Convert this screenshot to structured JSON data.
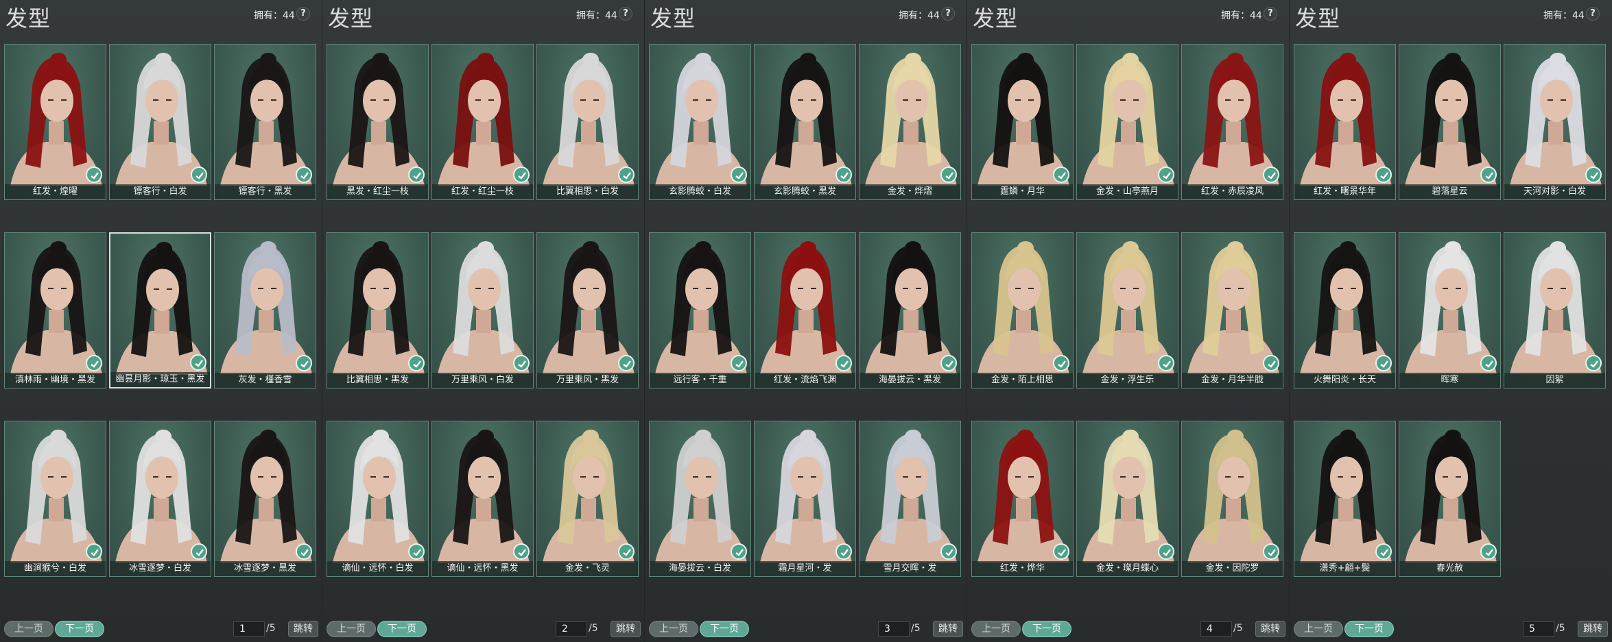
{
  "panels": [
    {
      "title": "发型",
      "owned": "拥有：44",
      "help": "?",
      "prev": "上一页",
      "next": "下一页",
      "page": "1",
      "total": "/5",
      "jump": "跳转",
      "items": [
        {
          "label": "红发・煌曜",
          "hair": "#8a1212"
        },
        {
          "label": "镖客行・白发",
          "hair": "#d8d8d8"
        },
        {
          "label": "镖客行・黑发",
          "hair": "#1a1616"
        },
        {
          "label": "滇林雨・幽境・黑发",
          "hair": "#181414"
        },
        {
          "label": "幽昙月影・琼玉・黑发",
          "hair": "#151212",
          "selected": true
        },
        {
          "label": "灰发・槿香雪",
          "hair": "#b8bcc8"
        },
        {
          "label": "幽涧猴兮・白发",
          "hair": "#dadada"
        },
        {
          "label": "冰雪逐梦・白发",
          "hair": "#e0e0e0"
        },
        {
          "label": "冰雪逐梦・黑发",
          "hair": "#1a1515"
        }
      ]
    },
    {
      "title": "发型",
      "owned": "拥有：44",
      "help": "?",
      "prev": "上一页",
      "next": "下一页",
      "page": "2",
      "total": "/5",
      "jump": "跳转",
      "items": [
        {
          "label": "黑发・红尘一枝",
          "hair": "#1a1515"
        },
        {
          "label": "红发・红尘一枝",
          "hair": "#7a1010"
        },
        {
          "label": "比翼相思・白发",
          "hair": "#d8d8d8"
        },
        {
          "label": "比翼相思・黑发",
          "hair": "#181414"
        },
        {
          "label": "万里乘风・白发",
          "hair": "#dcdcdc"
        },
        {
          "label": "万里乘风・黑发",
          "hair": "#1a1515"
        },
        {
          "label": "谪仙・远怀・白发",
          "hair": "#e2e2e2"
        },
        {
          "label": "谪仙・远怀・黑发",
          "hair": "#1a1515"
        },
        {
          "label": "金发・飞灵",
          "hair": "#d9c79a"
        }
      ]
    },
    {
      "title": "发型",
      "owned": "拥有：44",
      "help": "?",
      "prev": "上一页",
      "next": "下一页",
      "page": "3",
      "total": "/5",
      "jump": "跳转",
      "items": [
        {
          "label": "玄影腾蛟・白发",
          "hair": "#d4d6dc"
        },
        {
          "label": "玄影腾蛟・黑发",
          "hair": "#161313"
        },
        {
          "label": "金发・烨熠",
          "hair": "#e6d6a8"
        },
        {
          "label": "远行客・千重",
          "hair": "#171313"
        },
        {
          "label": "红发・流焰飞渊",
          "hair": "#8c1010"
        },
        {
          "label": "海晏拔云・黑发",
          "hair": "#141111"
        },
        {
          "label": "海晏拔云・白发",
          "hair": "#d0d0d0"
        },
        {
          "label": "霜月星河・发",
          "hair": "#d6d6dc"
        },
        {
          "label": "雪月交晖・发",
          "hair": "#c8ccd4"
        }
      ]
    },
    {
      "title": "发型",
      "owned": "拥有：44",
      "help": "?",
      "prev": "上一页",
      "next": "下一页",
      "page": "4",
      "total": "/5",
      "jump": "跳转",
      "items": [
        {
          "label": "霆鳞・月华",
          "hair": "#141111"
        },
        {
          "label": "金发・山亭燕月",
          "hair": "#e4d3a0"
        },
        {
          "label": "红发・赤辰凌风",
          "hair": "#8a1414"
        },
        {
          "label": "金发・陌上相思",
          "hair": "#d8c48e"
        },
        {
          "label": "金发・浮生乐",
          "hair": "#dcc892"
        },
        {
          "label": "金发・月华半胧",
          "hair": "#e0cc98"
        },
        {
          "label": "红发・烨华",
          "hair": "#8c1212"
        },
        {
          "label": "金发・璨月蝶心",
          "hair": "#e6dcb4"
        },
        {
          "label": "金发・因陀罗",
          "hair": "#d2c08c"
        }
      ]
    },
    {
      "title": "发型",
      "owned": "拥有：44",
      "help": "?",
      "prev": "上一页",
      "next": "下一页",
      "page": "5",
      "total": "/5",
      "jump": "跳转",
      "items": [
        {
          "label": "红发・曙景华年",
          "hair": "#861212"
        },
        {
          "label": "碧落星云",
          "hair": "#151212"
        },
        {
          "label": "天河对影・白发",
          "hair": "#dcdce4"
        },
        {
          "label": "火舞阳炎・长天",
          "hair": "#161313"
        },
        {
          "label": "晖寒",
          "hair": "#e4e4e4"
        },
        {
          "label": "因絮",
          "hair": "#e2e2e2"
        },
        {
          "label": "潇秀+翩+鬓",
          "hair": "#151212"
        },
        {
          "label": "春光赦",
          "hair": "#141111"
        }
      ]
    }
  ]
}
